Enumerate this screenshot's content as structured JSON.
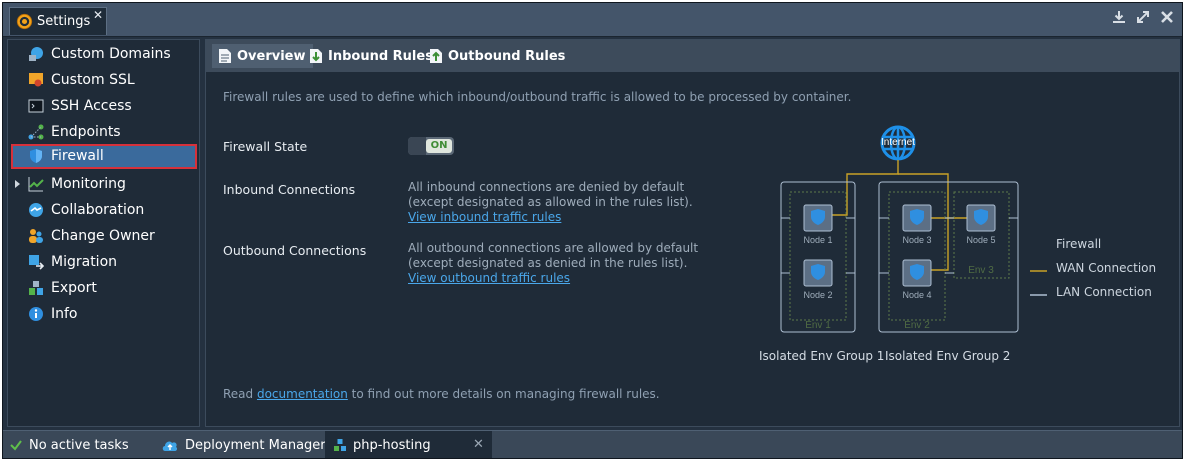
{
  "window": {
    "tab_title": "Settings",
    "close_glyph": "✕",
    "controls": [
      "download-icon",
      "expand-icon",
      "close-icon"
    ]
  },
  "sidebar": {
    "items": [
      {
        "label": "Custom Domains",
        "icon": "custom-domains-icon"
      },
      {
        "label": "Custom SSL",
        "icon": "ssl-certificate-icon"
      },
      {
        "label": "SSH Access",
        "icon": "terminal-icon"
      },
      {
        "label": "Endpoints",
        "icon": "endpoints-icon"
      },
      {
        "label": "Firewall",
        "icon": "shield-icon",
        "active": true
      },
      {
        "label": "Monitoring",
        "icon": "monitoring-chart-icon",
        "expandable": true
      },
      {
        "label": "Collaboration",
        "icon": "handshake-icon"
      },
      {
        "label": "Change Owner",
        "icon": "users-icon"
      },
      {
        "label": "Migration",
        "icon": "migration-icon"
      },
      {
        "label": "Export",
        "icon": "export-icon"
      },
      {
        "label": "Info",
        "icon": "info-icon"
      }
    ]
  },
  "tabs": [
    {
      "label": "Overview",
      "icon": "document-icon",
      "active": true
    },
    {
      "label": "Inbound Rules",
      "icon": "inbound-arrow-icon"
    },
    {
      "label": "Outbound Rules",
      "icon": "outbound-arrow-icon"
    }
  ],
  "overview": {
    "intro": "Firewall rules are used to define which inbound/outbound traffic is allowed to be processed by container.",
    "firewall_state": {
      "label": "Firewall State",
      "toggle_text": "ON",
      "enabled": true
    },
    "inbound": {
      "label": "Inbound Connections",
      "line1": "All inbound connections are denied by default",
      "line2": "(except designated as allowed in the rules list).",
      "link": "View inbound traffic rules"
    },
    "outbound": {
      "label": "Outbound Connections",
      "line1": "All outbound connections are allowed by default",
      "line2": "(except designated as denied in the rules list).",
      "link": "View outbound traffic rules"
    },
    "footnote": {
      "prefix": "Read ",
      "link": "documentation",
      "suffix": " to find out more details on managing firewall rules."
    }
  },
  "diagram": {
    "internet_label": "Internet",
    "nodes": [
      "Node 1",
      "Node 2",
      "Node 3",
      "Node 4",
      "Node 5"
    ],
    "envs": [
      "Env 1",
      "Env 2",
      "Env 3"
    ],
    "groups": [
      "Isolated Env Group 1",
      "Isolated Env Group 2"
    ],
    "legend": [
      {
        "label": "Firewall"
      },
      {
        "label": "WAN Connection",
        "color": "#c9a227"
      },
      {
        "label": "LAN Connection",
        "color": "#aebfd2"
      }
    ],
    "colors": {
      "wan": "#c9a227",
      "lan": "#aebfd2",
      "globe": "#1e90e8",
      "node": "#5c6f85"
    }
  },
  "taskbar": {
    "items": [
      {
        "label": "No active tasks",
        "icon": "check-icon"
      },
      {
        "label": "Deployment Manager",
        "icon": "cloud-upload-icon"
      },
      {
        "label": "php-hosting",
        "icon": "environment-icon"
      }
    ],
    "close_glyph": "✕"
  }
}
